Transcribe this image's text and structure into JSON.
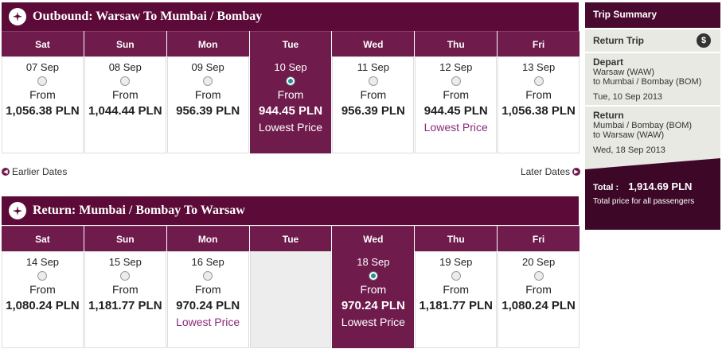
{
  "outbound": {
    "title": "Outbound: Warsaw To Mumbai / Bombay",
    "days": [
      "Sat",
      "Sun",
      "Mon",
      "Tue",
      "Wed",
      "Thu",
      "Fri"
    ],
    "cells": [
      {
        "date": "07 Sep",
        "from": "From",
        "price": "1,056.38 PLN",
        "lowest": "",
        "selected": false
      },
      {
        "date": "08 Sep",
        "from": "From",
        "price": "1,044.44 PLN",
        "lowest": "",
        "selected": false
      },
      {
        "date": "09 Sep",
        "from": "From",
        "price": "956.39 PLN",
        "lowest": "",
        "selected": false
      },
      {
        "date": "10 Sep",
        "from": "From",
        "price": "944.45 PLN",
        "lowest": "Lowest Price",
        "selected": true
      },
      {
        "date": "11 Sep",
        "from": "From",
        "price": "956.39 PLN",
        "lowest": "",
        "selected": false
      },
      {
        "date": "12 Sep",
        "from": "From",
        "price": "944.45 PLN",
        "lowest": "Lowest Price",
        "selected": false
      },
      {
        "date": "13 Sep",
        "from": "From",
        "price": "1,056.38 PLN",
        "lowest": "",
        "selected": false
      }
    ]
  },
  "nav": {
    "earlier": "Earlier Dates",
    "later": "Later Dates"
  },
  "return": {
    "title": "Return: Mumbai / Bombay To Warsaw",
    "days": [
      "Sat",
      "Sun",
      "Mon",
      "Tue",
      "Wed",
      "Thu",
      "Fri"
    ],
    "cells": [
      {
        "date": "14 Sep",
        "from": "From",
        "price": "1,080.24 PLN",
        "lowest": "",
        "selected": false
      },
      {
        "date": "15 Sep",
        "from": "From",
        "price": "1,181.77 PLN",
        "lowest": "",
        "selected": false
      },
      {
        "date": "16 Sep",
        "from": "From",
        "price": "970.24 PLN",
        "lowest": "Lowest Price",
        "selected": false
      },
      {
        "date": "",
        "from": "",
        "price": "",
        "lowest": "",
        "selected": false,
        "empty": true
      },
      {
        "date": "18 Sep",
        "from": "From",
        "price": "970.24 PLN",
        "lowest": "Lowest Price",
        "selected": true
      },
      {
        "date": "19 Sep",
        "from": "From",
        "price": "1,181.77 PLN",
        "lowest": "",
        "selected": false
      },
      {
        "date": "20 Sep",
        "from": "From",
        "price": "1,080.24 PLN",
        "lowest": "",
        "selected": false
      }
    ]
  },
  "summary": {
    "title": "Trip Summary",
    "trip_type": "Return Trip",
    "depart_label": "Depart",
    "depart_from": "Warsaw (WAW)",
    "depart_to": "to Mumbai / Bombay (BOM)",
    "depart_date": "Tue, 10 Sep 2013",
    "return_label": "Return",
    "return_from": "Mumbai / Bombay (BOM)",
    "return_to": "to Warsaw (WAW)",
    "return_date": "Wed, 18 Sep 2013",
    "total_label": "Total :",
    "total_value": "1,914.69  PLN",
    "total_note": "Total price for all passengers"
  },
  "colors": {
    "brand": "#5c0b38",
    "header": "#6f1b4c",
    "lowest": "#8b2a7a"
  }
}
